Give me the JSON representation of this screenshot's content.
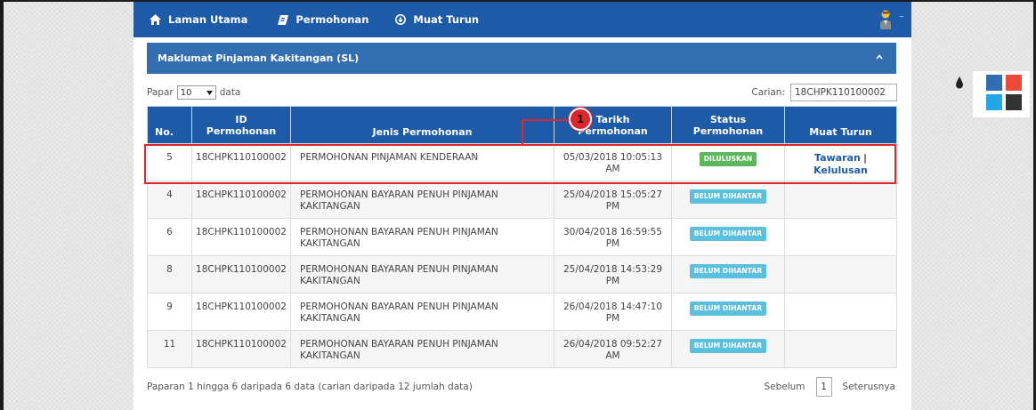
{
  "navbar": {
    "items": [
      {
        "label": "Laman Utama",
        "icon": "home-icon"
      },
      {
        "label": "Permohonan",
        "icon": "pencil-icon"
      },
      {
        "label": "Muat Turun",
        "icon": "download-circle-icon"
      }
    ]
  },
  "panel": {
    "title": "Maklumat Pinjaman Kakitangan (SL)"
  },
  "controls": {
    "show_prefix": "Papar",
    "length_value": "10",
    "show_suffix": "data",
    "search_label": "Carian:",
    "search_value": "18CHPK110100002"
  },
  "table": {
    "headers": {
      "no": "No.",
      "id_line1": "ID",
      "id_line2": "Permohonan",
      "jenis": "Jenis Permohonan",
      "tarikh_line1": "Tarikh",
      "tarikh_line2": "Permohonan",
      "status_line1": "Status",
      "status_line2": "Permohonan",
      "muat": "Muat Turun"
    },
    "rows": [
      {
        "no": "5",
        "id": "18CHPK110100002",
        "jenis_line1": "PERMOHONAN PINJAMAN KENDERAAN",
        "jenis_line2": "",
        "tarikh_line1": "05/03/2018 10:05:13",
        "tarikh_line2": "AM",
        "status": "DILULUSKAN",
        "link1": "Tawaran",
        "sep": "|",
        "link2": "Kelulusan"
      },
      {
        "no": "4",
        "id": "18CHPK110100002",
        "jenis_line1": "PERMOHONAN BAYARAN PENUH PINJAMAN",
        "jenis_line2": "KAKITANGAN",
        "tarikh_line1": "25/04/2018 15:05:27",
        "tarikh_line2": "PM",
        "status": "BELUM DIHANTAR"
      },
      {
        "no": "6",
        "id": "18CHPK110100002",
        "jenis_line1": "PERMOHONAN BAYARAN PENUH PINJAMAN",
        "jenis_line2": "KAKITANGAN",
        "tarikh_line1": "30/04/2018 16:59:55",
        "tarikh_line2": "PM",
        "status": "BELUM DIHANTAR"
      },
      {
        "no": "8",
        "id": "18CHPK110100002",
        "jenis_line1": "PERMOHONAN BAYARAN PENUH PINJAMAN",
        "jenis_line2": "KAKITANGAN",
        "tarikh_line1": "25/04/2018 14:53:29",
        "tarikh_line2": "PM",
        "status": "BELUM DIHANTAR"
      },
      {
        "no": "9",
        "id": "18CHPK110100002",
        "jenis_line1": "PERMOHONAN BAYARAN PENUH PINJAMAN",
        "jenis_line2": "KAKITANGAN",
        "tarikh_line1": "26/04/2018 14:47:10",
        "tarikh_line2": "PM",
        "status": "BELUM DIHANTAR"
      },
      {
        "no": "11",
        "id": "18CHPK110100002",
        "jenis_line1": "PERMOHONAN BAYARAN PENUH PINJAMAN",
        "jenis_line2": "KAKITANGAN",
        "tarikh_line1": "26/04/2018 09:52:27",
        "tarikh_line2": "AM",
        "status": "BELUM DIHANTAR"
      }
    ]
  },
  "footer": {
    "info": "Paparan 1 hingga 6 daripada 6 data (carian daripada 12 jumlah data)",
    "prev": "Sebelum",
    "page": "1",
    "next": "Seterusnya"
  },
  "annotation": {
    "marker": "1"
  },
  "colors": {
    "navbar": "#1d5aa7",
    "panel_header": "#336fb0",
    "badge_approved": "#5cb85c",
    "badge_pending": "#5bc0de",
    "highlight": "#e0262c",
    "swatch_blue": "#2f6db5",
    "swatch_red": "#ee4a3a",
    "swatch_cyan": "#22a7e6",
    "swatch_dark": "#333333"
  }
}
